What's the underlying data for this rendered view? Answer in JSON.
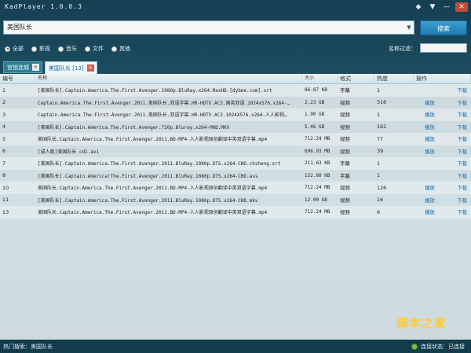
{
  "app": {
    "title": "KadPlayer 1.0.0.3"
  },
  "window_controls": [
    {
      "name": "skin-icon",
      "glyph": "◆"
    },
    {
      "name": "menu-icon",
      "glyph": "▼"
    },
    {
      "name": "minimize-icon",
      "glyph": "—"
    },
    {
      "name": "close-icon",
      "glyph": "✕"
    }
  ],
  "search": {
    "value": "美国队长",
    "button_label": "搜索"
  },
  "filters": {
    "options": [
      {
        "label": "全部",
        "checked": true
      },
      {
        "label": "影视",
        "checked": false
      },
      {
        "label": "音乐",
        "checked": false
      },
      {
        "label": "文件",
        "checked": false
      },
      {
        "label": "其他",
        "checked": false
      }
    ],
    "name_filter_label": "名称过滤：",
    "name_filter_value": ""
  },
  "tabs": [
    {
      "label": "宫锁连城",
      "active": false
    },
    {
      "label": "美国队长 [13]",
      "active": true
    }
  ],
  "table": {
    "headers": [
      "编号",
      "名称",
      "大小",
      "格式",
      "热度",
      "操作"
    ],
    "play_label": "播放",
    "download_label": "下载",
    "rows": [
      {
        "id": "1",
        "name": "[美国队长].Captain.America.The.First.Avenger.1080p.BluRay.x264.MaxHD.[dybee.com].srt",
        "size": "86.87 KB",
        "format": "字幕",
        "heat": "1",
        "play": false
      },
      {
        "id": "2",
        "name": "Captain.America.The.First.Avenger.2011.美国队长.双语字幕.HR-HDTV.AC3.国英双语.1024x576.x264-…",
        "size": "2.23 GB",
        "format": "视频",
        "heat": "316",
        "play": true
      },
      {
        "id": "3",
        "name": "Captain.America.The.First.Avenger.2011.美国队长.双语字幕.HR-HDTV.AC3.1024X576.x264-人人影视…",
        "size": "1.90 GB",
        "format": "视频",
        "heat": "1",
        "play": true
      },
      {
        "id": "4",
        "name": "[美国队长].Captain.America.The.First.Avenger.720p.Bluray.x264-MHD.MKV",
        "size": "5.46 GB",
        "format": "视频",
        "heat": "161",
        "play": true
      },
      {
        "id": "5",
        "name": "美国队长.Captain.America.The.First.Avenger.2011.BD-MP4-人人影视原创翻译中英双语字幕.mp4",
        "size": "712.24 MB",
        "format": "视频",
        "heat": "77",
        "play": true
      },
      {
        "id": "6",
        "name": "[成人版]美国队长 cd1.avi",
        "size": "696.93 MB",
        "format": "视频",
        "heat": "39",
        "play": true
      },
      {
        "id": "7",
        "name": "[美国队长].Captain.America.The.First.Avenger.2011.BluRay.1080p.DTS.x264-CHD.chsheng.srt",
        "size": "211.63 KB",
        "format": "字幕",
        "heat": "1",
        "play": false
      },
      {
        "id": "8",
        "name": "[美国队长].Captain.America!The.First.Avenger.2011.BluRay.1080p.DTS.x264-CHD.ass",
        "size": "152.80 KB",
        "format": "字幕",
        "heat": "1",
        "play": false
      },
      {
        "id": "10",
        "name": "美国队长.Captain.America.The.First.Avenger.2011.BD-MP4-人人影视原创翻译中英双语字幕.mp4",
        "size": "712.24 MB",
        "format": "视频",
        "heat": "126",
        "play": true
      },
      {
        "id": "11",
        "name": "[美国队长].Captain.America.The.First.Avenger.2011.BluRay.1080p.DTS.x264-CHD.mkv",
        "size": "12.00 GB",
        "format": "视频",
        "heat": "16",
        "play": true
      },
      {
        "id": "13",
        "name": "美国队长.Captain.America.The.First.Avenger.2011.BD-MP4-人人影视原创翻译中英双语字幕.mp4",
        "size": "712.24 MB",
        "format": "视频",
        "heat": "6",
        "play": true
      }
    ]
  },
  "status": {
    "hot_search": "热门搜索：美国队长",
    "connection": "连接状态：已连接"
  },
  "watermark": {
    "text": "脚本之家",
    "url": "www.jb51.net"
  },
  "colors": {
    "accent": "#1f7ab0",
    "link": "#1c6fb0",
    "tab_close_active": "#e05a4a",
    "connected": "#7cc043"
  }
}
